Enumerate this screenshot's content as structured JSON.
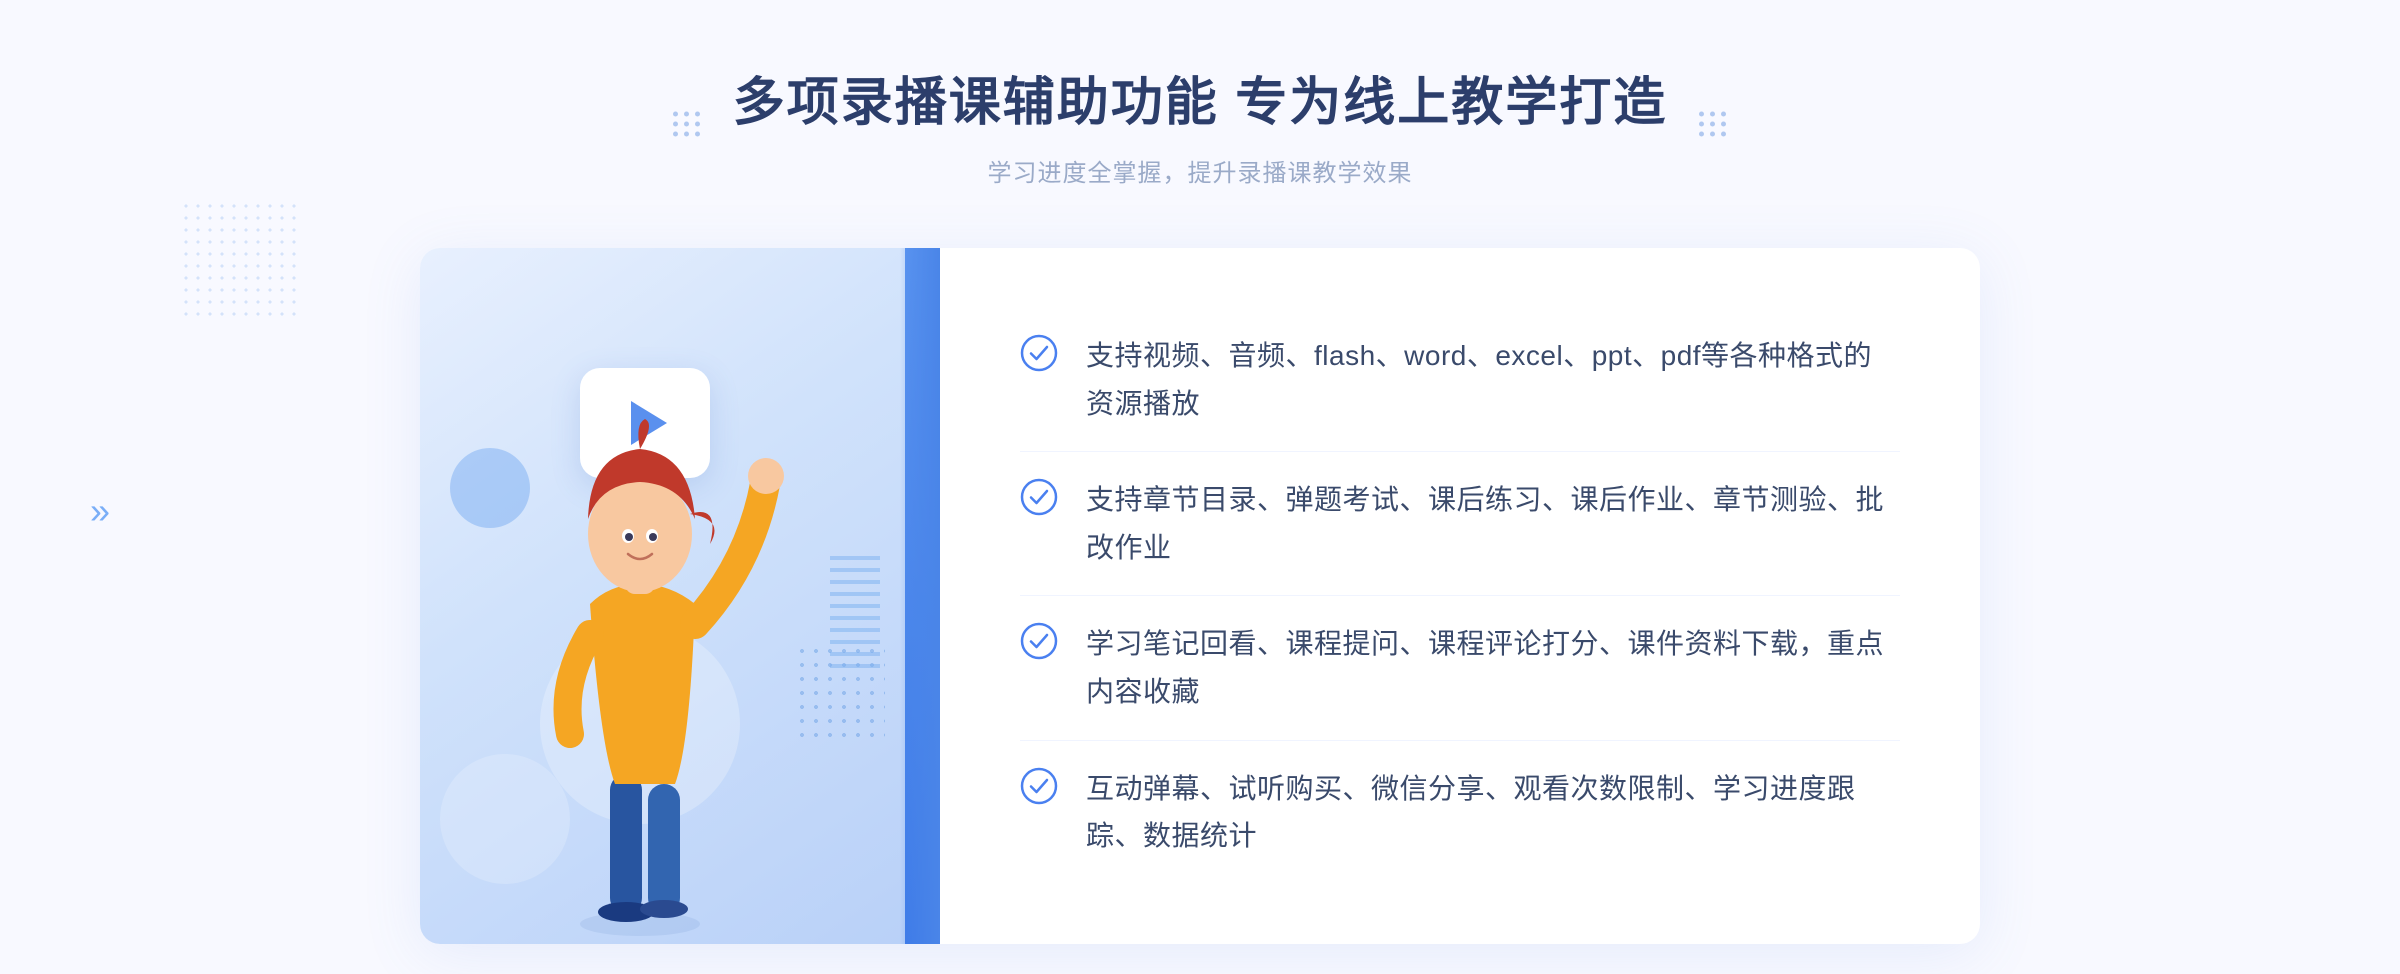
{
  "header": {
    "title": "多项录播课辅助功能 专为线上教学打造",
    "subtitle": "学习进度全掌握，提升录播课教学效果",
    "dots_label": "decorative dots"
  },
  "features": [
    {
      "id": 1,
      "text": "支持视频、音频、flash、word、excel、ppt、pdf等各种格式的资源播放"
    },
    {
      "id": 2,
      "text": "支持章节目录、弹题考试、课后练习、课后作业、章节测验、批改作业"
    },
    {
      "id": 3,
      "text": "学习笔记回看、课程提问、课程评论打分、课件资料下载，重点内容收藏"
    },
    {
      "id": 4,
      "text": "互动弹幕、试听购买、微信分享、观看次数限制、学习进度跟踪、数据统计"
    }
  ],
  "colors": {
    "primary_blue": "#4a7ef0",
    "title_color": "#2c3e6b",
    "text_color": "#3a4a6b",
    "subtitle_color": "#9aaac8",
    "check_color": "#4a80f0",
    "bg_light": "#f5f8ff"
  }
}
